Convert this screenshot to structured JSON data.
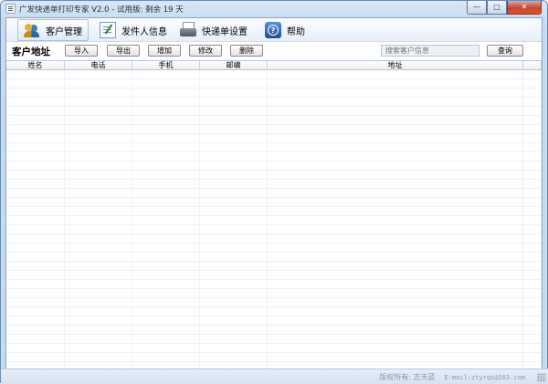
{
  "window": {
    "title": "广发快递单打印专家 V2.0 - 试用版: 剩余 19 天",
    "controls": {
      "minimize": "—",
      "maximize": "□",
      "close": "✕"
    }
  },
  "toolbar": {
    "items": [
      {
        "label": "客户管理",
        "icon": "users-icon",
        "active": true
      },
      {
        "label": "发件人信息",
        "icon": "sender-icon",
        "active": false
      },
      {
        "label": "快递单设置",
        "icon": "printer-icon",
        "active": false
      },
      {
        "label": "帮助",
        "icon": "help-icon",
        "active": false
      }
    ]
  },
  "section": {
    "title": "客户地址",
    "buttons": {
      "import": "导入",
      "export": "导出",
      "add": "增加",
      "edit": "修改",
      "delete": "删除"
    },
    "search_placeholder": "搜索客户信息",
    "query": "查询"
  },
  "table": {
    "columns": [
      "姓名",
      "电话",
      "手机",
      "邮编",
      "地址"
    ],
    "rows": []
  },
  "status": {
    "copyright": "版权所有: 志天蓝",
    "email": "E-mail:ztyrqs@163.com"
  }
}
